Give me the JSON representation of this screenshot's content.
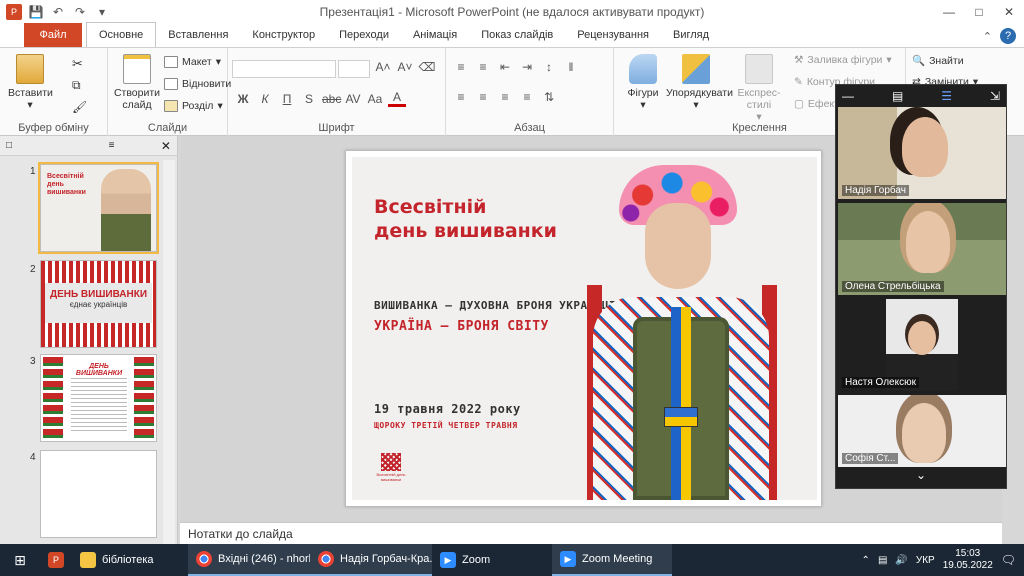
{
  "window": {
    "title": "Презентація1 - Microsoft PowerPoint (не вдалося активувати продукт)",
    "min_icon": "minimize-icon",
    "max_icon": "maximize-icon",
    "close_icon": "close-icon"
  },
  "tabs": [
    "Файл",
    "Основне",
    "Вставлення",
    "Конструктор",
    "Переходи",
    "Анімація",
    "Показ слайдів",
    "Рецензування",
    "Вигляд"
  ],
  "ribbon": {
    "clipboard": {
      "paste": "Вставити",
      "group": "Буфер обміну"
    },
    "slides": {
      "new_slide": "Створити слайд",
      "layout": "Макет",
      "reset": "Відновити",
      "section": "Розділ",
      "group": "Слайди"
    },
    "font": {
      "group": "Шрифт"
    },
    "paragraph": {
      "group": "Абзац"
    },
    "drawing": {
      "shapes": "Фігури",
      "arrange": "Упорядкувати",
      "quick_styles": "Експрес-стилі",
      "fill": "Заливка фігури",
      "outline": "Контур фігури",
      "effects": "Ефекти",
      "group": "Креслення"
    },
    "editing": {
      "find": "Знайти",
      "replace": "Замінити"
    }
  },
  "thumbnails": [
    {
      "num": "1",
      "title": "Всесвітній день вишиванки"
    },
    {
      "num": "2",
      "line1": "ДЕНЬ ВИШИВАНКИ",
      "line2": "єднає українців"
    },
    {
      "num": "3",
      "title": "ДЕНЬ ВИШИВАНКИ"
    },
    {
      "num": "4"
    }
  ],
  "slide": {
    "title_line1": "Всесвітній",
    "title_line2": "день вишиванки",
    "subtitle": "ВИШИВАНКА – ДУХОВНА БРОНЯ УКРАЇНЦІВ",
    "slogan": "УКРАЇНА – БРОНЯ СВІТУ",
    "date": "19 травня 2022 року",
    "date_note": "ЩОРОКУ ТРЕТІЙ ЧЕТВЕР ТРАВНЯ",
    "logo_text": "Всесвітній день вишиванки"
  },
  "notes_placeholder": "Нотатки до слайда",
  "zoom": {
    "participants": [
      "Надія Горбач",
      "Олена Стрельбіцька",
      "Настя Олексюк",
      "Софія Ст..."
    ]
  },
  "taskbar": {
    "items": [
      "бібліотека",
      "Вхідні (246) - nhorb...",
      "Надія Горбач-Кра...",
      "Zoom",
      "Zoom Meeting"
    ],
    "lang": "УКР",
    "time": "15:03",
    "date": "19.05.2022"
  },
  "colors": {
    "accent": "#d24726",
    "slide_red": "#c4242b",
    "taskbar": "#1b2735"
  }
}
